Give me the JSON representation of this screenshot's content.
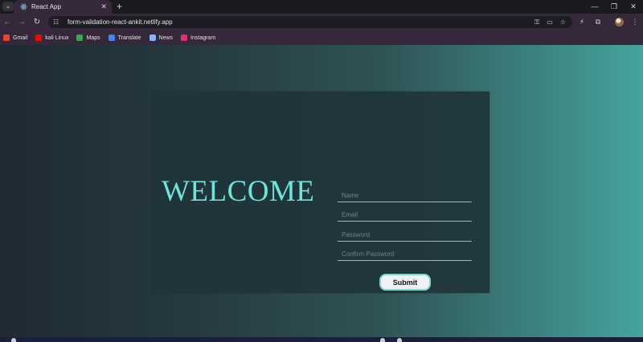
{
  "browser": {
    "tab_title": "React App",
    "tab_close": "✕",
    "new_tab": "+",
    "window_controls": {
      "minimize": "—",
      "restore": "❐",
      "close": "✕"
    },
    "nav": {
      "back": "←",
      "forward": "→",
      "reload": "↻"
    },
    "url": "form-validation-react-ankit.netlify.app",
    "bookmarks": [
      {
        "label": "Gmail",
        "color": "#ea4335"
      },
      {
        "label": "kali Linux",
        "color": "#ff0000"
      },
      {
        "label": "Maps",
        "color": "#34a853"
      },
      {
        "label": "Translate",
        "color": "#4285f4"
      },
      {
        "label": "News",
        "color": "#8ab4f8"
      },
      {
        "label": "Instagram",
        "color": "#e1306c"
      }
    ]
  },
  "form": {
    "heading": "WELCOME",
    "name_placeholder": "Name",
    "email_placeholder": "Email",
    "password_placeholder": "Password",
    "confirm_placeholder": "Confirm Password",
    "submit_label": "Submit"
  },
  "colors": {
    "accent": "#6ce5db",
    "card": "#20343a",
    "chrome": "#35283a"
  }
}
